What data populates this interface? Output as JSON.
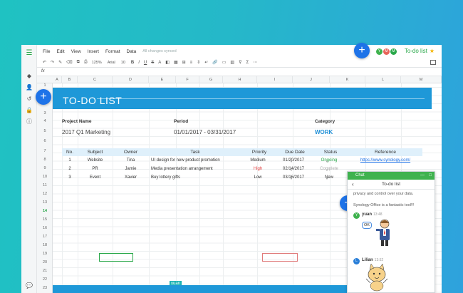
{
  "menu": {
    "items": [
      "File",
      "Edit",
      "View",
      "Insert",
      "Format",
      "Data"
    ],
    "sync_status": "All changes synced"
  },
  "doc_title": "To-do list",
  "collaborators": [
    {
      "initial": "Y",
      "color": "#3fb24e"
    },
    {
      "initial": "M",
      "color": "#e8645a"
    },
    {
      "initial": "M",
      "color": "#2aa84a"
    }
  ],
  "toolbar": {
    "zoom": "125%",
    "font": "Arial",
    "size": "10",
    "bold": "B",
    "italic": "I",
    "underline": "U",
    "strike": "S"
  },
  "fx": "fx",
  "columns": [
    "A",
    "B",
    "C",
    "D",
    "E",
    "F",
    "G",
    "H",
    "I",
    "J",
    "K",
    "L",
    "M"
  ],
  "rows": [
    "1",
    "2",
    "3",
    "4",
    "5",
    "6",
    "7",
    "8",
    "9",
    "10",
    "11",
    "12",
    "13",
    "14",
    "15",
    "16",
    "17",
    "18",
    "19",
    "20",
    "21",
    "22",
    "23",
    "24"
  ],
  "banner_title": "TO-DO LIST",
  "info": {
    "project_name_label": "Project Name",
    "project_name": "2017 Q1 Marketing",
    "period_label": "Period",
    "period": "01/01/2017 - 03/31/2017",
    "category_label": "Category",
    "category": "WORK"
  },
  "table": {
    "headers": [
      "No.",
      "Subject",
      "Owner",
      "Task",
      "Priority",
      "Due Date",
      "Status",
      "Reference"
    ],
    "rows": [
      {
        "no": "1",
        "subject": "Website",
        "owner": "Tina",
        "task": "UI design for new product promotion",
        "priority": "Medium",
        "due": "01/20/2017",
        "status": "Ongoing",
        "ref": "https://www.synology.com/"
      },
      {
        "no": "2",
        "subject": "PR",
        "owner": "Jamie",
        "task": "Media presentation arrangement",
        "priority": "High",
        "due": "02/14/2017",
        "status": "Complete",
        "ref": ""
      },
      {
        "no": "3",
        "subject": "Event",
        "owner": "Xavier",
        "task": "Buy lottery gifts",
        "priority": "Low",
        "due": "03/16/2017",
        "status": "New",
        "ref": ""
      }
    ]
  },
  "colors": {
    "ongoing": "#2aa84a",
    "complete": "#aaaaaa",
    "high": "#e23c3c",
    "link": "#1e73e8"
  },
  "cursor_user": "yuan",
  "chat": {
    "title": "Chat",
    "room": "To-do list",
    "intro_text": "privacy and control over your data.",
    "intro_text2": "Synology Office is a fantastic tool!!!",
    "user1": {
      "initial": "Y",
      "name": "yuan",
      "time": "13:48",
      "bubble": "OK",
      "color": "#3fb24e"
    },
    "user2": {
      "initial": "L",
      "name": "Lilian",
      "time": "13:52",
      "color": "#2a7fd8"
    }
  }
}
